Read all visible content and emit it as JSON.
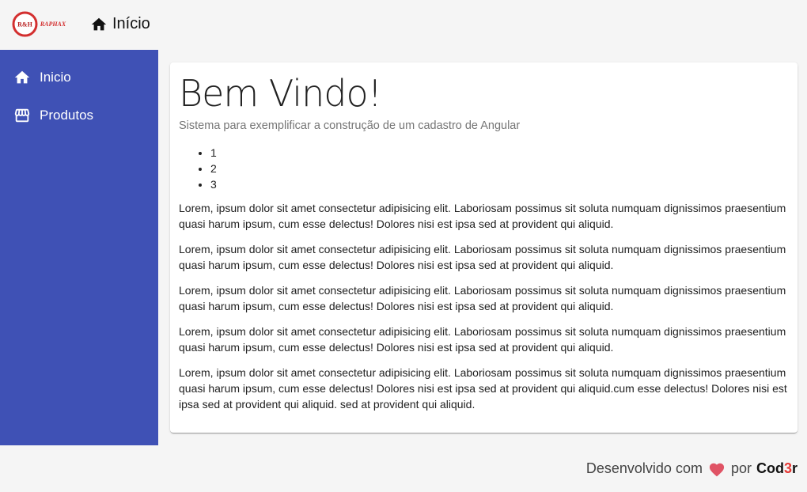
{
  "header": {
    "logo_text": "R&H RAPHAX",
    "title": "Início",
    "title_icon": "home-icon"
  },
  "sidebar": {
    "items": [
      {
        "label": "Inicio",
        "icon": "home-icon"
      },
      {
        "label": "Produtos",
        "icon": "storefront-icon"
      }
    ]
  },
  "main": {
    "heading": "Bem Vindo!",
    "subtitle": "Sistema para exemplificar a construção de um cadastro de Angular",
    "list": [
      "1",
      "2",
      "3"
    ],
    "paragraphs": [
      "Lorem, ipsum dolor sit amet consectetur adipisicing elit. Laboriosam possimus sit soluta numquam dignissimos praesentium quasi harum ipsum, cum esse delectus! Dolores nisi est ipsa sed at provident qui aliquid.",
      "Lorem, ipsum dolor sit amet consectetur adipisicing elit. Laboriosam possimus sit soluta numquam dignissimos praesentium quasi harum ipsum, cum esse delectus! Dolores nisi est ipsa sed at provident qui aliquid.",
      "Lorem, ipsum dolor sit amet consectetur adipisicing elit. Laboriosam possimus sit soluta numquam dignissimos praesentium quasi harum ipsum, cum esse delectus! Dolores nisi est ipsa sed at provident qui aliquid.",
      "Lorem, ipsum dolor sit amet consectetur adipisicing elit. Laboriosam possimus sit soluta numquam dignissimos praesentium quasi harum ipsum, cum esse delectus! Dolores nisi est ipsa sed at provident qui aliquid.",
      "Lorem, ipsum dolor sit amet consectetur adipisicing elit. Laboriosam possimus sit soluta numquam dignissimos praesentium quasi harum ipsum, cum esse delectus! Dolores nisi est ipsa sed at provident qui aliquid.cum esse delectus! Dolores nisi est ipsa sed at provident qui aliquid. sed at provident qui aliquid."
    ]
  },
  "footer": {
    "prefix": "Desenvolvido com",
    "heart_icon": "heart-icon",
    "by": "por",
    "brand_a": "Cod",
    "brand_b": "3",
    "brand_c": "r"
  },
  "colors": {
    "sidebar": "#3f51b5",
    "heart": "#e05365",
    "brand_accent": "#e53935"
  }
}
